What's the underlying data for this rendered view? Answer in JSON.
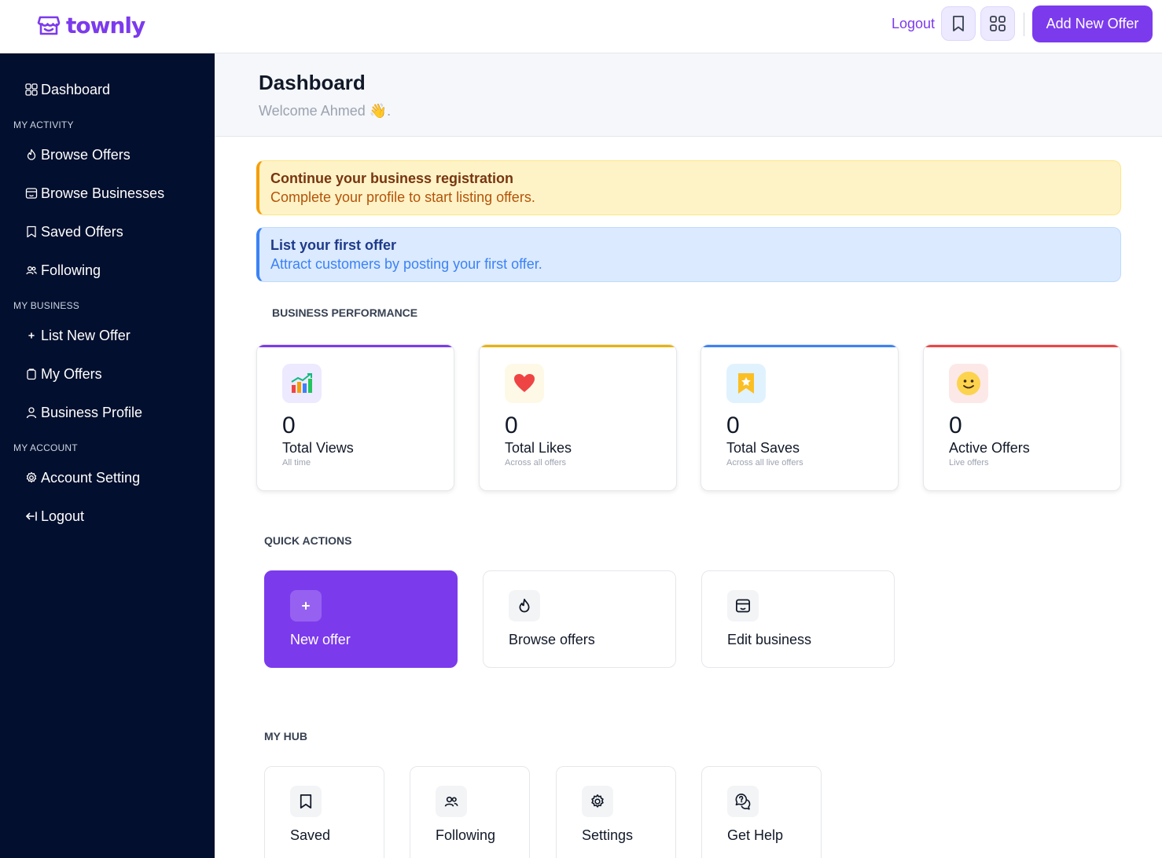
{
  "brand": {
    "name": "townly",
    "color": "#7c3aed"
  },
  "topbar": {
    "logout_label": "Logout",
    "add_offer_label": "Add New Offer",
    "icons": [
      "bookmark-icon",
      "grid-icon"
    ]
  },
  "sidebar": {
    "dashboard_label": "Dashboard",
    "sections": {
      "activity": "MY ACTIVITY",
      "business": "MY BUSINESS",
      "account": "MY ACCOUNT"
    },
    "items": {
      "browse_offers": "Browse Offers",
      "browse_businesses": "Browse Businesses",
      "saved_offers": "Saved Offers",
      "following": "Following",
      "list_new_offer": "List New Offer",
      "my_offers": "My Offers",
      "business_profile": "Business Profile",
      "account_setting": "Account Setting",
      "logout": "Logout"
    }
  },
  "header": {
    "title": "Dashboard",
    "welcome": "Welcome Ahmed 👋."
  },
  "alerts": {
    "registration": {
      "title": "Continue your business registration",
      "body": "Complete your profile to start listing offers."
    },
    "first_offer": {
      "title": "List your first offer",
      "body": "Attract customers by posting your first offer."
    }
  },
  "performance": {
    "label": "BUSINESS PERFORMANCE",
    "stats": [
      {
        "value": "0",
        "label": "Total Views",
        "sub": "All time",
        "accent": "#7c3aed",
        "icon": "chart-icon"
      },
      {
        "value": "0",
        "label": "Total Likes",
        "sub": "Across all offers",
        "accent": "#eab308",
        "icon": "heart-icon"
      },
      {
        "value": "0",
        "label": "Total Saves",
        "sub": "Across all live offers",
        "accent": "#3b82f6",
        "icon": "star-bookmark-icon"
      },
      {
        "value": "0",
        "label": "Active Offers",
        "sub": "Live offers",
        "accent": "#ef4444",
        "icon": "smiley-icon"
      }
    ]
  },
  "quick_actions": {
    "label": "QUICK ACTIONS",
    "items": {
      "new_offer": "New offer",
      "browse_offers": "Browse offers",
      "edit_business": "Edit business"
    }
  },
  "hub": {
    "label": "MY HUB",
    "items": {
      "saved": "Saved",
      "following": "Following",
      "settings": "Settings",
      "get_help": "Get Help"
    }
  }
}
